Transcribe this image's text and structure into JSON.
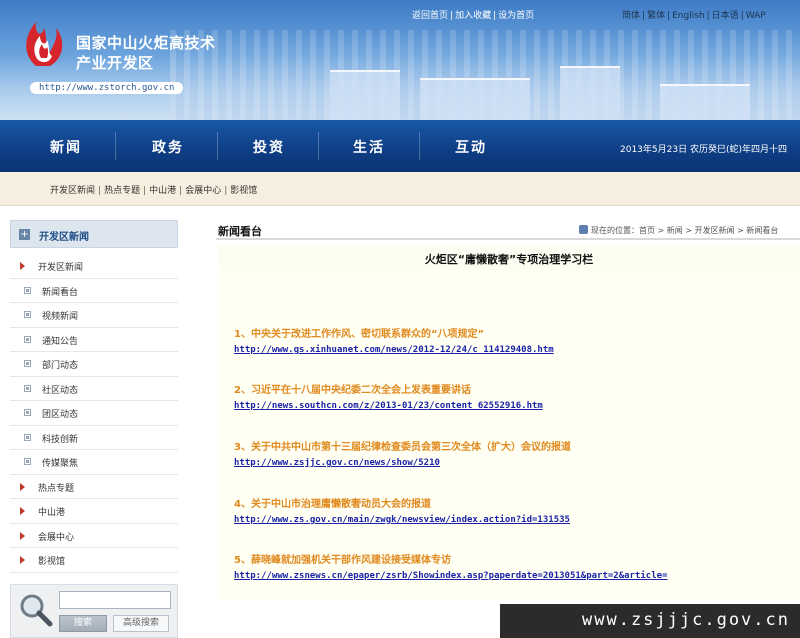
{
  "header": {
    "site_name_line1": "国家中山火炬高技术",
    "site_name_line2": "产业开发区",
    "site_url": "http://www.zstorch.gov.cn",
    "top_links": [
      "返回首页",
      "加入收藏",
      "设为首页"
    ],
    "lang_links": [
      "简体",
      "繁体",
      "English",
      "日本语",
      "WAP"
    ],
    "brand_color": "#1a5aa6"
  },
  "nav": {
    "items": [
      "新闻",
      "政务",
      "投资",
      "生活",
      "互动"
    ],
    "date": "2013年5月23日 农历癸巳(蛇)年四月十四"
  },
  "subnav": {
    "items": [
      "开发区新闻",
      "热点专题",
      "中山港",
      "会展中心",
      "影视馆"
    ]
  },
  "sidebar": {
    "header": "开发区新闻",
    "rows": [
      {
        "label": "开发区新闻",
        "type": "top"
      },
      {
        "label": "新闻看台",
        "type": "sub"
      },
      {
        "label": "视频新闻",
        "type": "sub"
      },
      {
        "label": "通知公告",
        "type": "sub"
      },
      {
        "label": "部门动态",
        "type": "sub"
      },
      {
        "label": "社区动态",
        "type": "sub"
      },
      {
        "label": "团区动态",
        "type": "sub"
      },
      {
        "label": "科技创新",
        "type": "sub"
      },
      {
        "label": "传媒聚焦",
        "type": "sub"
      },
      {
        "label": "热点专题",
        "type": "top"
      },
      {
        "label": "中山港",
        "type": "top"
      },
      {
        "label": "会展中心",
        "type": "top"
      },
      {
        "label": "影视馆",
        "type": "top"
      }
    ]
  },
  "search": {
    "button": "搜索",
    "advanced": "高级搜索"
  },
  "main": {
    "section_title": "新闻看台",
    "breadcrumb": {
      "prefix": "现在的位置：",
      "items": [
        "首页",
        "新闻",
        "开发区新闻",
        "新闻看台"
      ]
    },
    "article_title": "火炬区“庸懒散奢”专项治理学习栏",
    "items": [
      {
        "title": "1、中央关于改进工作作风、密切联系群众的“八项规定”",
        "link": "http://www.gs.xinhuanet.com/news/2012-12/24/c_114129408.htm"
      },
      {
        "title": "2、习近平在十八届中央纪委二次全会上发表重要讲话",
        "link": "http://news.southcn.com/z/2013-01/23/content_62552916.htm"
      },
      {
        "title": "3、关于中共中山市第十三届纪律检查委员会第三次全体（扩大）会议的报道",
        "link": "http://www.zsjjc.gov.cn/news/show/5210"
      },
      {
        "title": "4、关于中山市治理庸懒散奢动员大会的报道",
        "link": "http://www.zs.gov.cn/main/zwgk/newsview/index.action?id=131535"
      },
      {
        "title": "5、薛晓峰就加强机关干部作风建设接受媒体专访",
        "link": "http://www.zsnews.cn/epaper/zsrb/Showindex.asp?paperdate=2013051&part=2&article="
      }
    ]
  },
  "watermark": "www.zsjjjc.gov.cn"
}
